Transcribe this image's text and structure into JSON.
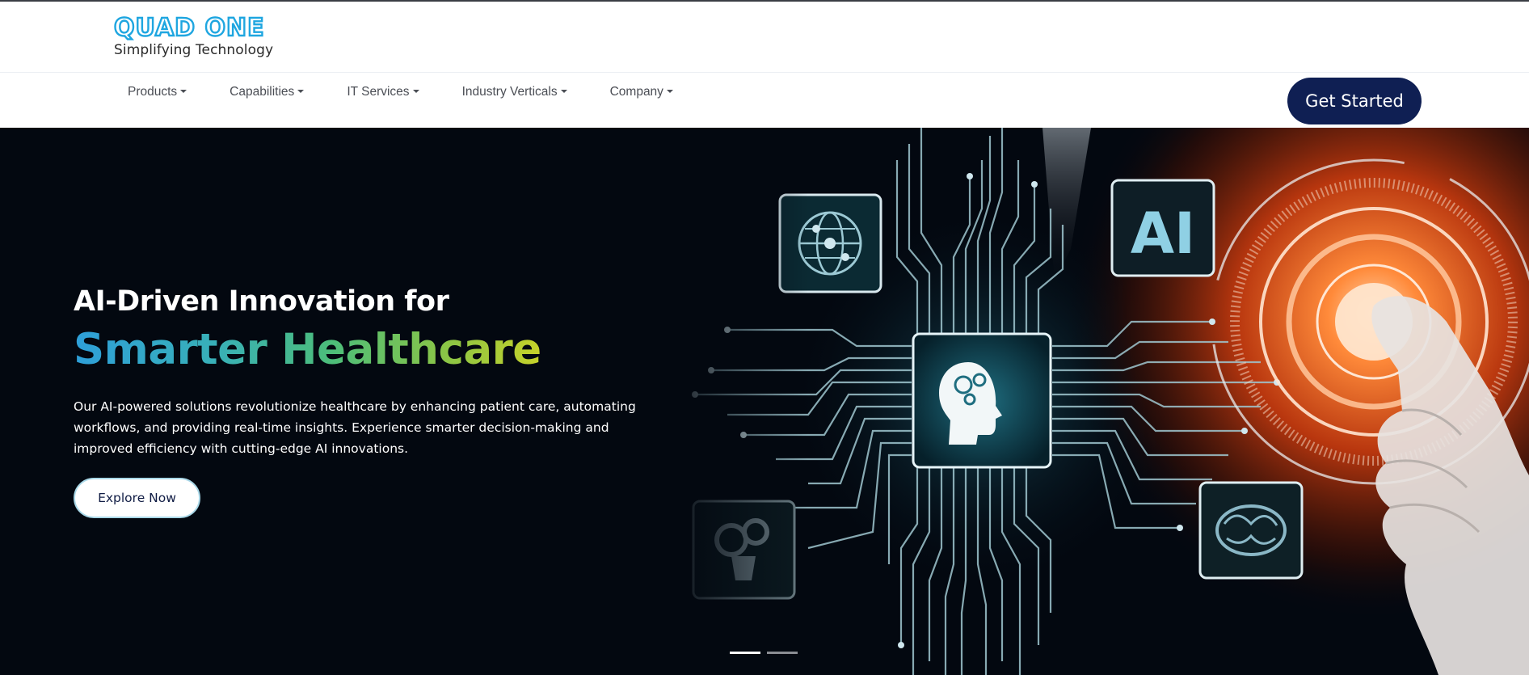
{
  "brand": {
    "name": "QUAD ONE",
    "tagline": "Simplifying Technology",
    "logo_color": "#1fa6e0"
  },
  "nav": {
    "items": [
      {
        "label": "Products",
        "icon": "caret-down-icon"
      },
      {
        "label": "Capabilities",
        "icon": "caret-down-icon"
      },
      {
        "label": "IT Services",
        "icon": "caret-down-icon"
      },
      {
        "label": "Industry Verticals",
        "icon": "caret-down-icon"
      },
      {
        "label": "Company",
        "icon": "caret-down-icon"
      }
    ],
    "cta_label": "Get Started",
    "cta_color": "#0f1f53"
  },
  "hero": {
    "title_line1": "AI-Driven Innovation for",
    "title_line2": "Smarter Healthcare",
    "description": "Our AI-powered solutions revolutionize healthcare by enhancing patient care, automating workflows, and providing real-time insights. Experience smarter decision-making and improved efficiency with cutting-edge AI innovations.",
    "button_label": "Explore Now",
    "image_badge_text": "AI",
    "image_icons": [
      "globe-icon",
      "ai-badge-icon",
      "head-gears-icon",
      "gears-bulb-icon",
      "brain-icon"
    ],
    "gradient_colors": [
      "#2e9fd9",
      "#4cbd7a",
      "#c6d22a"
    ],
    "background_color": "#030810"
  },
  "carousel": {
    "slides": 2,
    "active_slide": 1
  }
}
